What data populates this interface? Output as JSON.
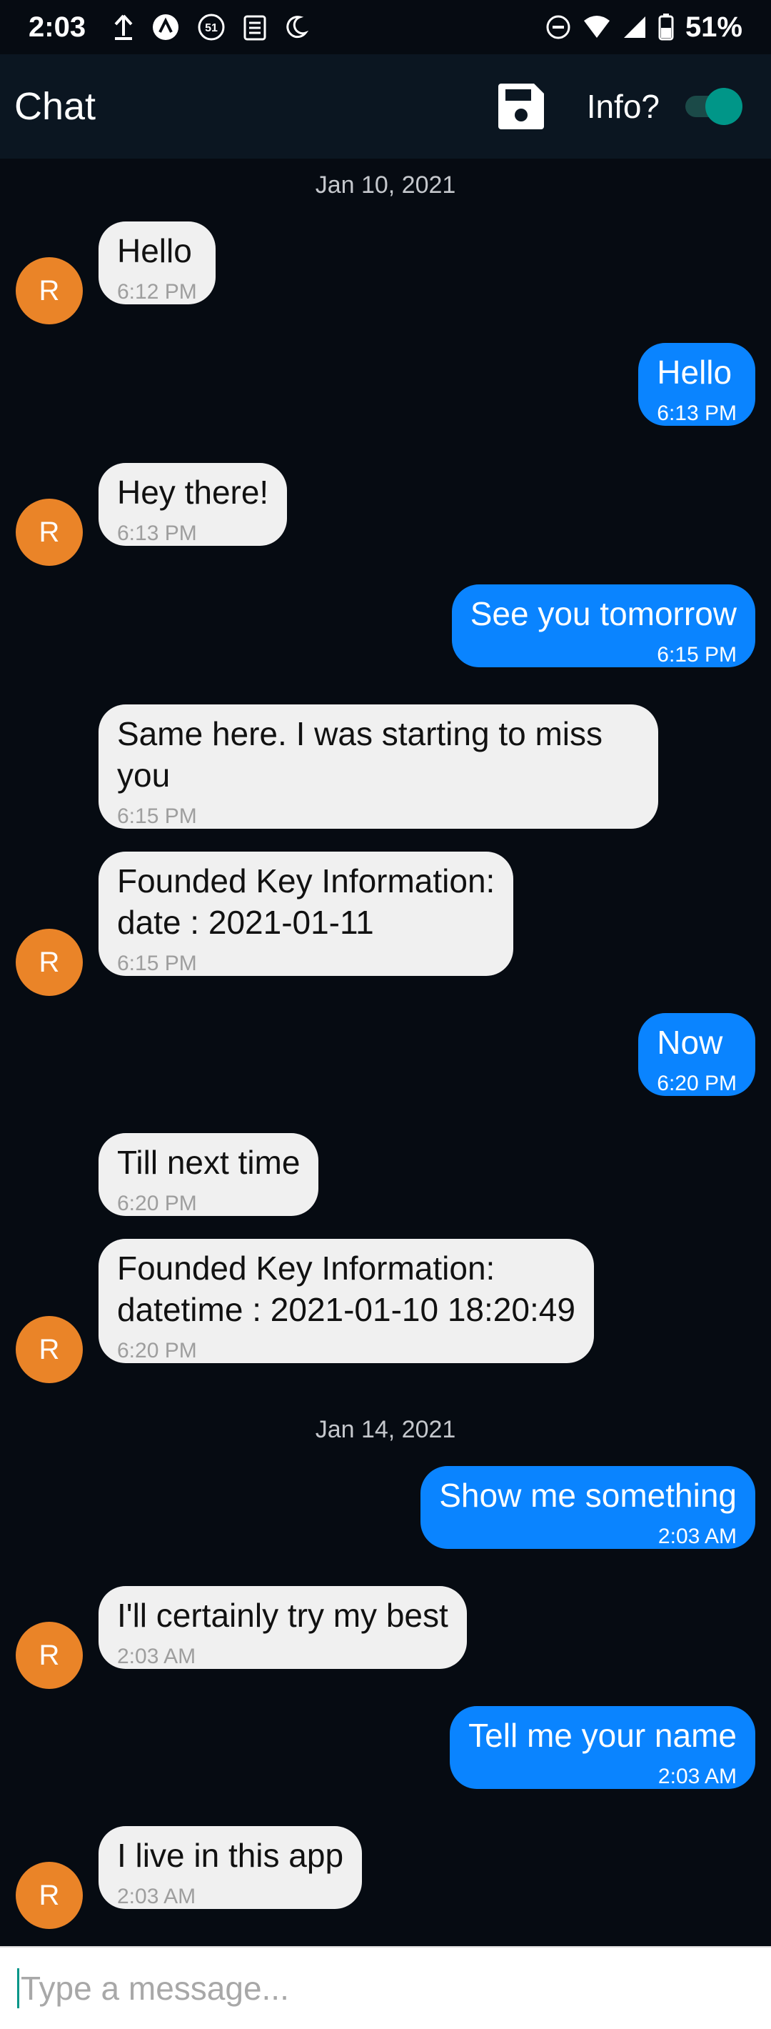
{
  "status_bar": {
    "time": "2:03",
    "notification_count": "51",
    "battery": "51%"
  },
  "app_bar": {
    "title": "Chat",
    "info_label": "Info?",
    "info_toggle_on": true,
    "accent_color": "#009688"
  },
  "chat": {
    "date_separators": [
      "Jan 10, 2021",
      "Jan 14, 2021"
    ],
    "avatar_initial": "R",
    "messages": [
      {
        "side": "in",
        "text": "Hello",
        "time": "6:12 PM"
      },
      {
        "side": "out",
        "text": "Hello",
        "time": "6:13 PM"
      },
      {
        "side": "in",
        "text": "Hey there!",
        "time": "6:13 PM"
      },
      {
        "side": "out",
        "text": "See you tomorrow",
        "time": "6:15 PM"
      },
      {
        "side": "in",
        "text": "Same here. I was starting to miss you",
        "time": "6:15 PM"
      },
      {
        "side": "in",
        "text": "Founded Key Information:\ndate : 2021-01-11",
        "time": "6:15 PM"
      },
      {
        "side": "out",
        "text": "Now",
        "time": "6:20 PM"
      },
      {
        "side": "in",
        "text": "Till next time",
        "time": "6:20 PM"
      },
      {
        "side": "in",
        "text": "Founded Key Information:\ndatetime : 2021-01-10 18:20:49",
        "time": "6:20 PM"
      },
      {
        "side": "out",
        "text": "Show me something",
        "time": "2:03 AM"
      },
      {
        "side": "in",
        "text": "I'll certainly try my best",
        "time": "2:03 AM"
      },
      {
        "side": "out",
        "text": "Tell me your name",
        "time": "2:03 AM"
      },
      {
        "side": "in",
        "text": "I live in this app",
        "time": "2:03 AM"
      }
    ]
  },
  "composer": {
    "value": "",
    "placeholder": "Type a message..."
  },
  "colors": {
    "background": "#060b12",
    "app_bar": "#0b1621",
    "outgoing_bubble": "#0a84ff",
    "incoming_bubble": "#f0f0f0",
    "avatar": "#ea8428"
  },
  "icons": [
    "upload-icon",
    "nav-arrow-icon",
    "notification-count-icon",
    "clipboard-icon",
    "night-mode-icon",
    "do-not-disturb-icon",
    "wifi-icon",
    "signal-icon",
    "battery-icon",
    "save-icon",
    "toggle-switch"
  ]
}
